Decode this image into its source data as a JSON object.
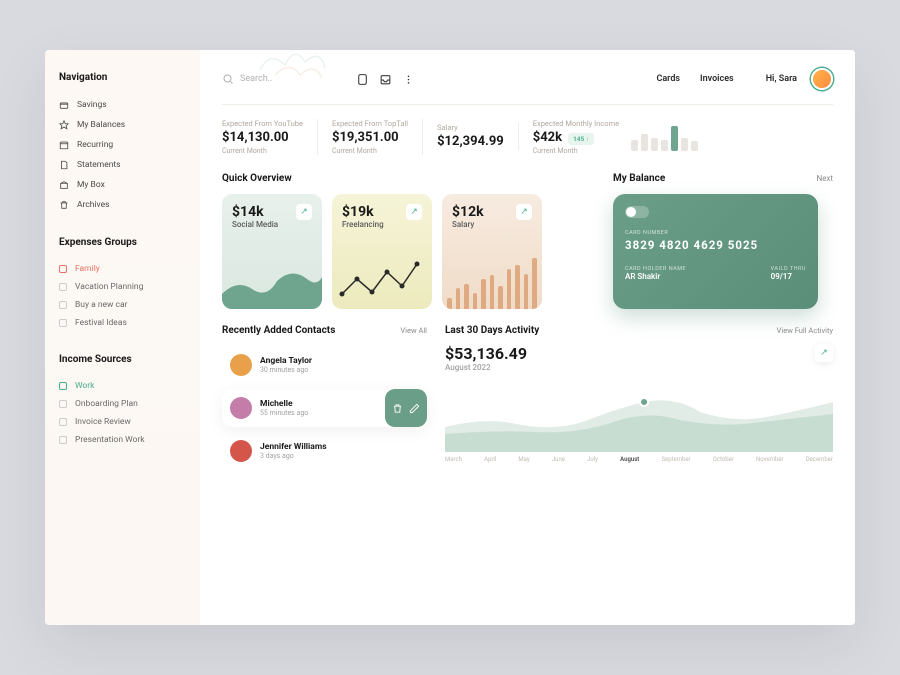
{
  "sidebar": {
    "nav_title": "Navigation",
    "nav_items": [
      {
        "label": "Savings",
        "icon": "wallet"
      },
      {
        "label": "My Balances",
        "icon": "star"
      },
      {
        "label": "Recurring",
        "icon": "calendar"
      },
      {
        "label": "Statements",
        "icon": "file"
      },
      {
        "label": "My Box",
        "icon": "box"
      },
      {
        "label": "Archives",
        "icon": "trash"
      }
    ],
    "groups_title": "Expenses  Groups",
    "groups": [
      {
        "label": "Family",
        "tone": "red"
      },
      {
        "label": "Vacation Planning"
      },
      {
        "label": "Buy a new car"
      },
      {
        "label": "Festival Ideas"
      }
    ],
    "income_title": "Income Sources",
    "income": [
      {
        "label": "Work",
        "tone": "teal"
      },
      {
        "label": "Onboarding Plan"
      },
      {
        "label": "Invoice Review"
      },
      {
        "label": "Presentation Work"
      }
    ]
  },
  "topbar": {
    "search_placeholder": "Search..",
    "link_cards": "Cards",
    "link_invoices": "Invoices",
    "greeting": "Hi, Sara"
  },
  "stats": {
    "s1_label": "Expected From YouTube",
    "s1_val": "$14,130.00",
    "s2_label": "Expected From TopTall",
    "s2_val": "$19,351.00",
    "s3_label": "Salary",
    "s3_val": "$12,394.99",
    "s4_label": "Expected Monthly Income",
    "s4_val": "$42k",
    "s4_badge": "145 ↑",
    "sub": "Current Month"
  },
  "overview": {
    "title": "Quick Overview",
    "c1_val": "$14k",
    "c1_lbl": "Social Media",
    "c2_val": "$19k",
    "c2_lbl": "Freelancing",
    "c3_val": "$12k",
    "c3_lbl": "Salary"
  },
  "balance": {
    "title": "My Balance",
    "next": "Next",
    "card_num_label": "CARD NUMBER",
    "card_num": "3829 4820 4629 5025",
    "holder_label": "CARD HOLDER NAME",
    "holder": "AR Shakir",
    "thru_label": "VAILD THRU",
    "thru": "09/17"
  },
  "contacts": {
    "title": "Recently Added Contacts",
    "view_all": "View All",
    "list": [
      {
        "name": "Angela Taylor",
        "time": "30 minutes ago",
        "bg": "#e8a04a"
      },
      {
        "name": "Michelle",
        "time": "55 minutes ago",
        "bg": "#c47da8",
        "active": true
      },
      {
        "name": "Jennifer Williams",
        "time": "3 days ago",
        "bg": "#d4564a"
      }
    ]
  },
  "activity": {
    "title": "Last 30 Days Activity",
    "view_full": "View Full Activity",
    "amount": "$53,136.49",
    "month": "August 2022",
    "months": [
      "March",
      "April",
      "May",
      "June",
      "July",
      "August",
      "September",
      "October",
      "November",
      "December"
    ]
  },
  "chart_data": [
    {
      "type": "bar",
      "title": "Expected Monthly Income sparkline",
      "values": [
        12,
        18,
        14,
        11,
        26,
        13,
        10
      ]
    },
    {
      "type": "area",
      "title": "Social Media",
      "values": [
        6,
        9,
        7,
        11,
        8,
        13,
        10
      ]
    },
    {
      "type": "line",
      "title": "Freelancing",
      "values": [
        4,
        8,
        5,
        10,
        6,
        12,
        9
      ]
    },
    {
      "type": "bar",
      "title": "Salary",
      "categories": [
        "1",
        "2",
        "3",
        "4",
        "5",
        "6",
        "7",
        "8",
        "9",
        "10",
        "11"
      ],
      "values": [
        10,
        18,
        22,
        14,
        26,
        30,
        20,
        34,
        38,
        30,
        44
      ]
    },
    {
      "type": "area",
      "title": "Last 30 Days Activity",
      "categories": [
        "March",
        "April",
        "May",
        "June",
        "July",
        "August",
        "September",
        "October",
        "November",
        "December"
      ],
      "values": [
        12,
        16,
        10,
        15,
        18,
        24,
        20,
        23,
        21,
        26
      ]
    }
  ]
}
